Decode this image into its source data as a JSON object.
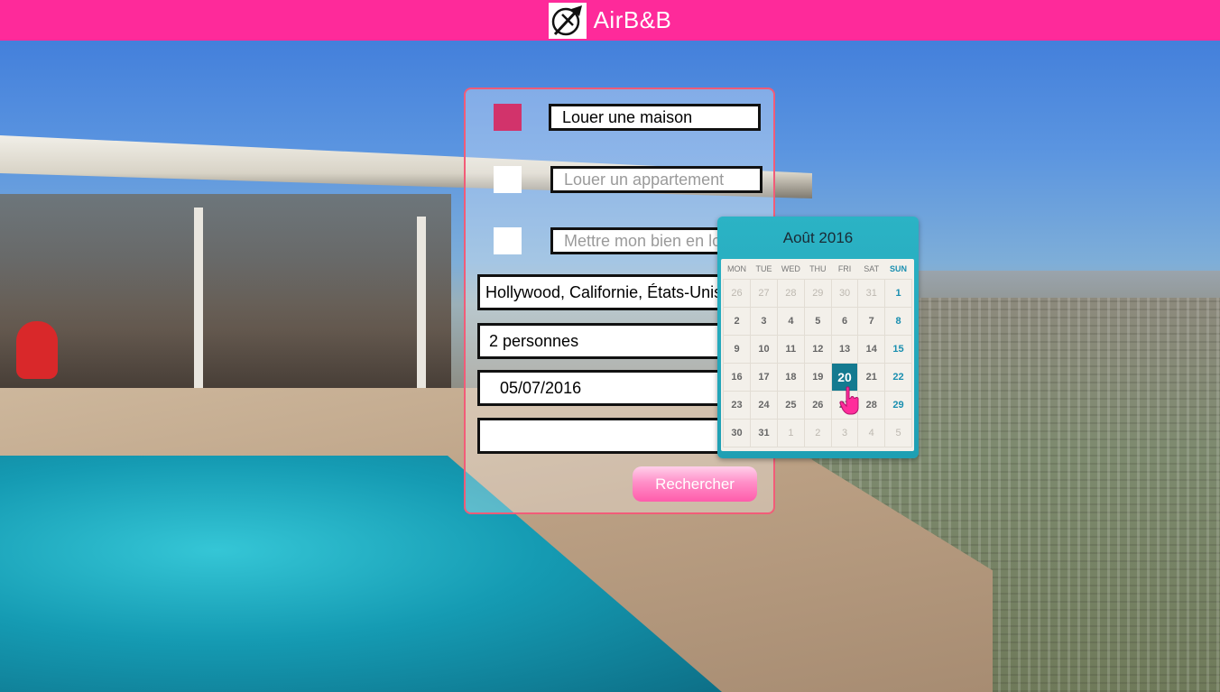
{
  "header": {
    "brand": "AirB&B",
    "logo_icon": "airplane-globe-icon",
    "bg_color": "#fe2a9a"
  },
  "form": {
    "options": [
      {
        "label": "Louer une maison",
        "checked": true
      },
      {
        "label": "Louer un appartement",
        "checked": false
      },
      {
        "label": "Mettre mon bien en location",
        "checked": false
      }
    ],
    "location": "Hollywood, Californie, États-Unis",
    "guests": "2 personnes",
    "date": "05/07/2016",
    "extra_value": "",
    "search_label": "Rechercher",
    "accent_color": "#d2336b"
  },
  "calendar": {
    "title": "Août 2016",
    "weekdays": [
      "MON",
      "TUE",
      "WED",
      "THU",
      "FRI",
      "SAT",
      "SUN"
    ],
    "weeks": [
      [
        "26",
        "27",
        "28",
        "29",
        "30",
        "31",
        "1"
      ],
      [
        "2",
        "3",
        "4",
        "5",
        "6",
        "7",
        "8"
      ],
      [
        "9",
        "10",
        "11",
        "12",
        "13",
        "14",
        "15"
      ],
      [
        "16",
        "17",
        "18",
        "19",
        "20",
        "21",
        "22"
      ],
      [
        "23",
        "24",
        "25",
        "26",
        "27",
        "28",
        "29"
      ],
      [
        "30",
        "31",
        "1",
        "2",
        "3",
        "4",
        "5"
      ]
    ],
    "selected_day": "20"
  }
}
